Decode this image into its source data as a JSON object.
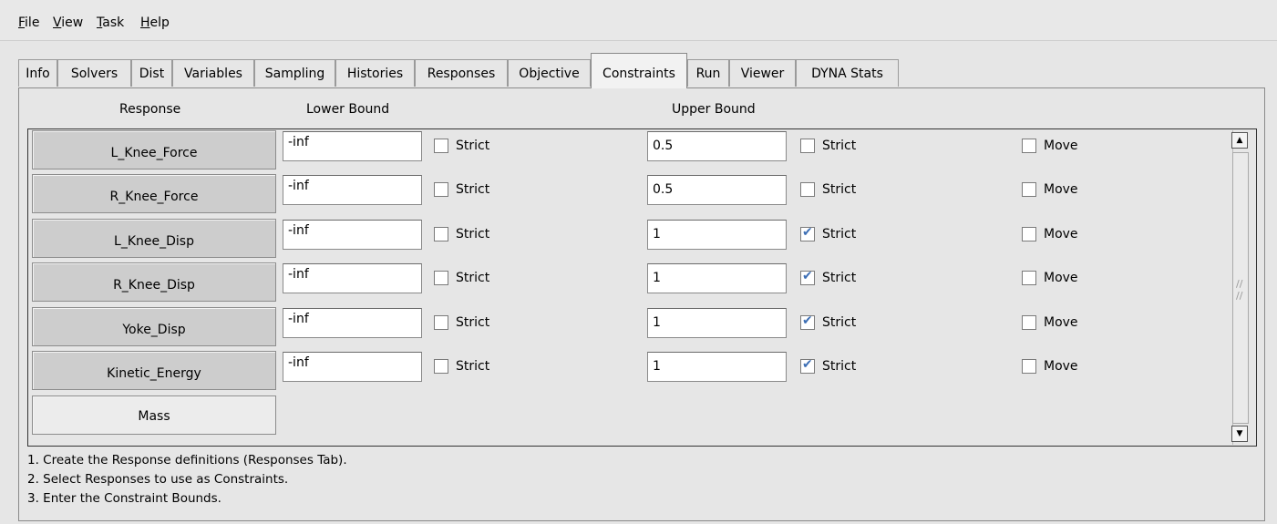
{
  "menu": [
    {
      "mnemonic": "F",
      "rest": "ile"
    },
    {
      "mnemonic": "V",
      "rest": "iew"
    },
    {
      "mnemonic": "T",
      "rest": "ask"
    },
    {
      "mnemonic": "H",
      "rest": "elp"
    }
  ],
  "tabs": [
    "Info",
    "Solvers",
    "Dist",
    "Variables",
    "Sampling",
    "Histories",
    "Responses",
    "Objective",
    "Constraints",
    "Run",
    "Viewer",
    "DYNA Stats"
  ],
  "active_tab": "Constraints",
  "headers": {
    "response": "Response",
    "lower": "Lower Bound",
    "upper": "Upper Bound"
  },
  "rows": [
    {
      "name": "L_Knee_Force",
      "lower": "-inf",
      "lower_strict": false,
      "upper": "0.5",
      "upper_strict": false,
      "move": false
    },
    {
      "name": "R_Knee_Force",
      "lower": "-inf",
      "lower_strict": false,
      "upper": "0.5",
      "upper_strict": false,
      "move": false
    },
    {
      "name": "L_Knee_Disp",
      "lower": "-inf",
      "lower_strict": false,
      "upper": "1",
      "upper_strict": true,
      "move": false
    },
    {
      "name": "R_Knee_Disp",
      "lower": "-inf",
      "lower_strict": false,
      "upper": "1",
      "upper_strict": true,
      "move": false
    },
    {
      "name": "Yoke_Disp",
      "lower": "-inf",
      "lower_strict": false,
      "upper": "1",
      "upper_strict": true,
      "move": false
    },
    {
      "name": "Kinetic_Energy",
      "lower": "-inf",
      "lower_strict": false,
      "upper": "1",
      "upper_strict": true,
      "move": false
    }
  ],
  "unselected_response": "Mass",
  "strict_label": "Strict",
  "move_label": "Move",
  "help": [
    "1. Create the Response definitions (Responses Tab).",
    "2. Select Responses to use as Constraints.",
    "3. Enter the Constraint Bounds."
  ],
  "icons": {
    "scroll_up": "arrow-up-icon",
    "scroll_down": "arrow-down-icon"
  }
}
